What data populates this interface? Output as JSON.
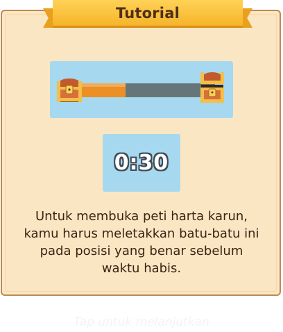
{
  "dialog": {
    "title": "Tutorial",
    "timer": "0:30",
    "progress": 0.38,
    "description_lines": [
      "Untuk membuka peti harta karun,",
      "kamu harus meletakkan batu-batu ini",
      "pada posisi yang benar sebelum",
      "waktu habis."
    ],
    "continue_hint": "Tap untuk melanjutkan"
  },
  "icons": {
    "start": "closed-treasure-chest-icon",
    "end": "open-treasure-chest-icon"
  },
  "colors": {
    "panel_bg": "#fbe6c3",
    "panel_border": "#b98b55",
    "ribbon": "#f6b42a",
    "info_box": "#a6d8ef",
    "progress_fill": "#ec8f25",
    "progress_track": "#66757a",
    "text": "#3a2414"
  }
}
